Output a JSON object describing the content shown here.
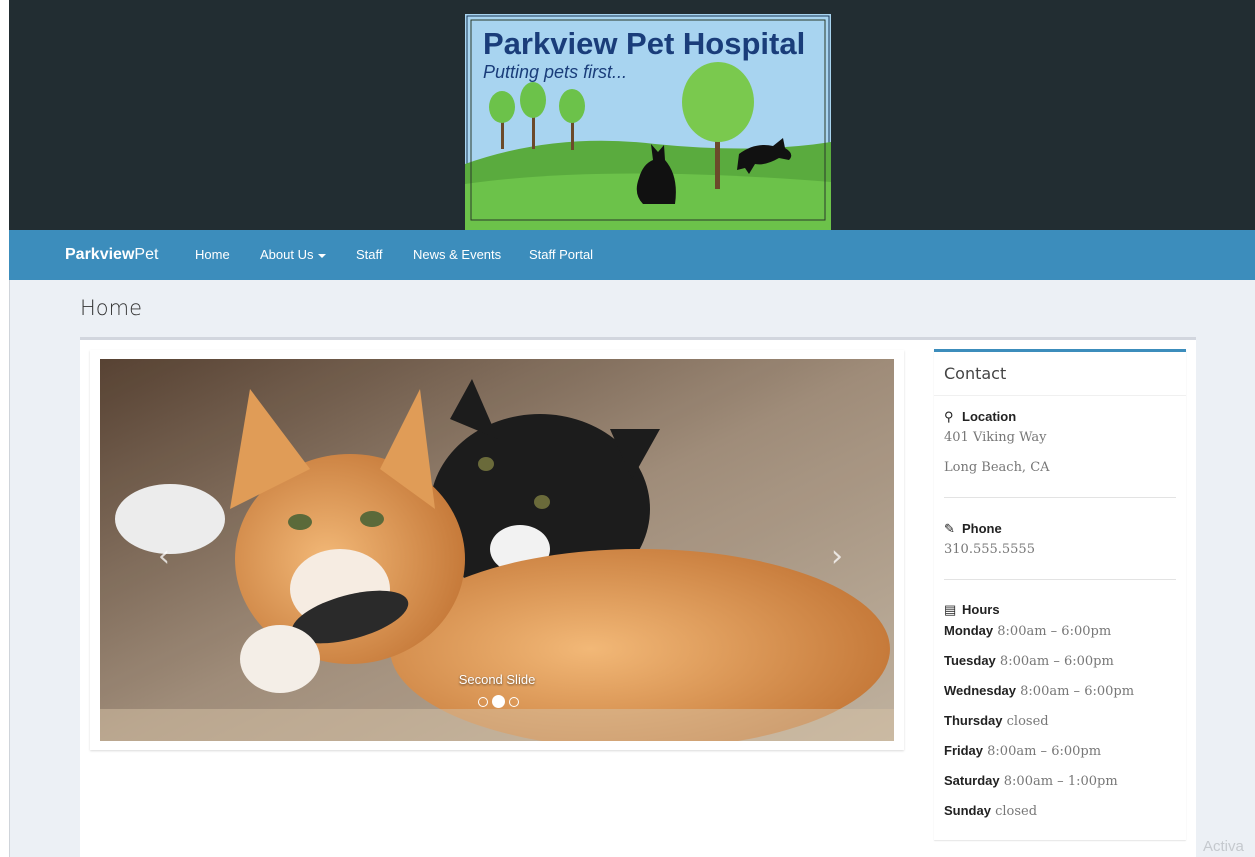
{
  "logo": {
    "title": "Parkview Pet Hospital",
    "tagline": "Putting pets first..."
  },
  "navbar": {
    "brand_bold": "Parkview",
    "brand_rest": "Pet",
    "items": [
      {
        "label": "Home"
      },
      {
        "label": "About Us"
      },
      {
        "label": "Staff"
      },
      {
        "label": "News & Events"
      },
      {
        "label": "Staff Portal"
      }
    ]
  },
  "page": {
    "title": "Home"
  },
  "carousel": {
    "caption": "Second Slide",
    "prev_icon": "chevron-left-icon",
    "next_icon": "chevron-right-icon",
    "slide_count": 3,
    "active_index": 2
  },
  "contact": {
    "title": "Contact",
    "location": {
      "label": "Location",
      "icon": "map-marker-icon",
      "line1": "401 Viking Way",
      "line2": "Long Beach, CA"
    },
    "phone": {
      "label": "Phone",
      "icon": "pencil-icon",
      "number": "310.555.5555"
    },
    "hours": {
      "label": "Hours",
      "icon": "document-icon",
      "days": [
        {
          "day": "Monday",
          "time": "8:00am – 6:00pm"
        },
        {
          "day": "Tuesday",
          "time": "8:00am – 6:00pm"
        },
        {
          "day": "Wednesday",
          "time": "8:00am – 6:00pm"
        },
        {
          "day": "Thursday",
          "time": "closed"
        },
        {
          "day": "Friday",
          "time": "8:00am – 6:00pm"
        },
        {
          "day": "Saturday",
          "time": "8:00am – 1:00pm"
        },
        {
          "day": "Sunday",
          "time": "closed"
        }
      ]
    }
  },
  "watermark": "Activa",
  "colors": {
    "header": "#222d32",
    "navbar": "#3c8dbc",
    "background": "#ecf0f5",
    "box_accent": "#3c8dbc"
  }
}
